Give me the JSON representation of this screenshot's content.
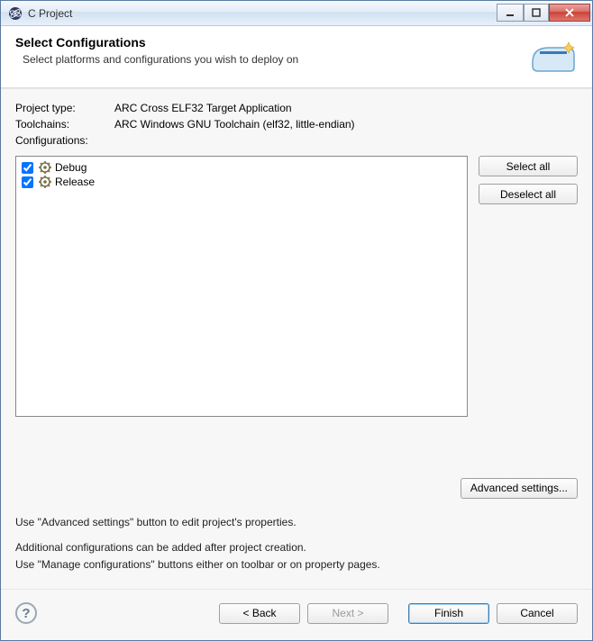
{
  "titlebar": {
    "title": "C Project"
  },
  "header": {
    "title": "Select Configurations",
    "subtitle": "Select platforms and configurations you wish to deploy on"
  },
  "info": {
    "project_type_label": "Project type:",
    "project_type_value": "ARC Cross ELF32 Target Application",
    "toolchains_label": "Toolchains:",
    "toolchains_value": "ARC Windows GNU Toolchain (elf32, little-endian)",
    "configurations_label": "Configurations:"
  },
  "configs": [
    {
      "label": "Debug",
      "checked": true
    },
    {
      "label": "Release",
      "checked": true
    }
  ],
  "buttons": {
    "select_all": "Select all",
    "deselect_all": "Deselect all",
    "advanced": "Advanced settings...",
    "back": "< Back",
    "next": "Next >",
    "finish": "Finish",
    "cancel": "Cancel"
  },
  "tips": {
    "line1": "Use \"Advanced settings\" button to edit project's properties.",
    "line2": "Additional configurations can be added after project creation.",
    "line3": "Use \"Manage configurations\" buttons either on toolbar or on property pages."
  }
}
